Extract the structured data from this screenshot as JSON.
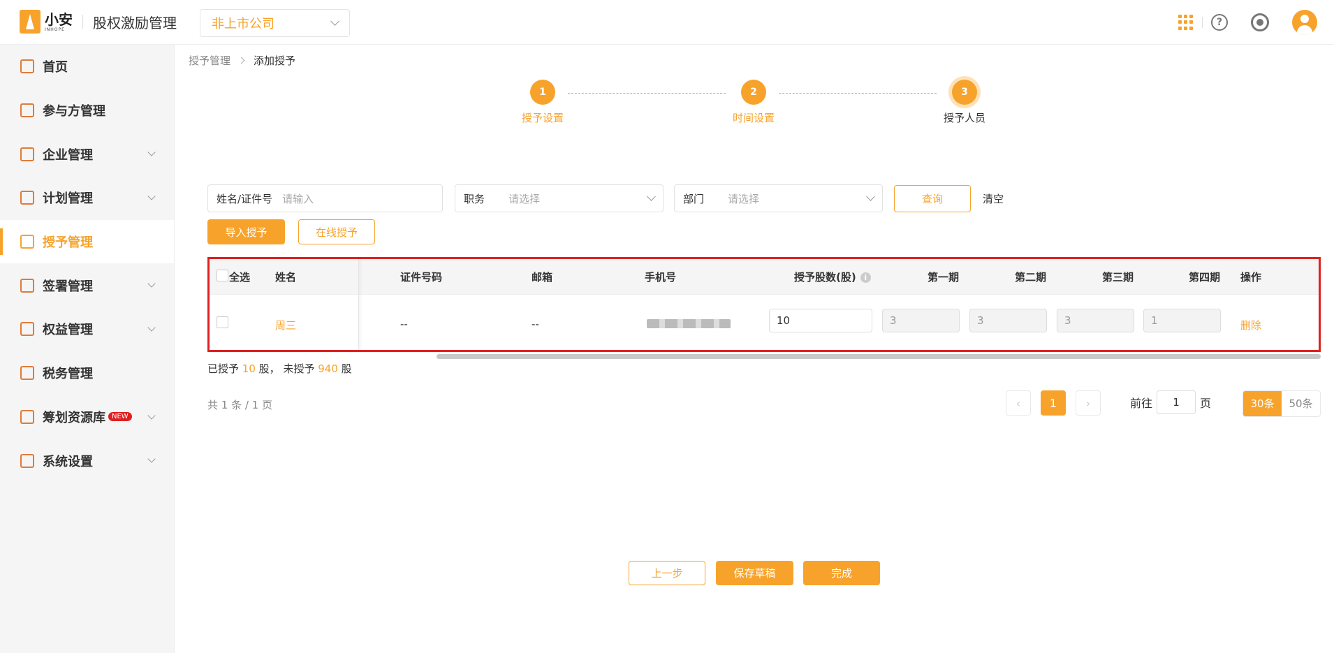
{
  "header": {
    "logo_cn": "小安",
    "logo_en": "INHOPE",
    "app_title": "股权激励管理",
    "company_select": "非上市公司",
    "help_symbol": "?"
  },
  "sidebar": {
    "items": [
      {
        "label": "首页",
        "icon": "home-icon"
      },
      {
        "label": "参与方管理",
        "icon": "users-icon"
      },
      {
        "label": "企业管理",
        "icon": "enterprise-icon"
      },
      {
        "label": "计划管理",
        "icon": "plan-icon"
      },
      {
        "label": "授予管理",
        "icon": "grant-icon"
      },
      {
        "label": "签署管理",
        "icon": "sign-icon"
      },
      {
        "label": "权益管理",
        "icon": "equity-icon"
      },
      {
        "label": "税务管理",
        "icon": "tax-icon"
      },
      {
        "label": "筹划资源库",
        "icon": "layers-icon",
        "badge": "NEW"
      },
      {
        "label": "系统设置",
        "icon": "settings-icon"
      }
    ]
  },
  "breadcrumb": {
    "parent": "授予管理",
    "current": "添加授予"
  },
  "steps": [
    {
      "num": "1",
      "label": "授予设置"
    },
    {
      "num": "2",
      "label": "时间设置"
    },
    {
      "num": "3",
      "label": "授予人员"
    }
  ],
  "filters": {
    "name_label": "姓名/证件号",
    "name_placeholder": "请输入",
    "position_label": "职务",
    "position_placeholder": "请选择",
    "dept_label": "部门",
    "dept_placeholder": "请选择",
    "query": "查询",
    "clear": "清空"
  },
  "actions": {
    "import": "导入授予",
    "online": "在线授予"
  },
  "table": {
    "headers": {
      "select_all": "全选",
      "name": "姓名",
      "id_no": "证件号码",
      "email": "邮箱",
      "phone": "手机号",
      "shares": "授予股数(股)",
      "p1": "第一期",
      "p2": "第二期",
      "p3": "第三期",
      "p4": "第四期",
      "op": "操作"
    },
    "rows": [
      {
        "name": "周三",
        "id_no": "--",
        "email": "--",
        "shares": "10",
        "p1": "3",
        "p2": "3",
        "p3": "3",
        "p4": "1",
        "op": "删除"
      }
    ],
    "info_symbol": "i"
  },
  "summary": {
    "granted_pre": "已授予",
    "granted": "10",
    "granted_unit": "股，",
    "ungranted_pre": "未授予",
    "ungranted": "940",
    "ungranted_unit": "股"
  },
  "pagination": {
    "total_text": "共 1 条 / 1 页",
    "current": "1",
    "goto_pre": "前往",
    "goto_value": "1",
    "goto_post": "页",
    "size_30": "30条",
    "size_50": "50条",
    "prev": "‹",
    "next": "›"
  },
  "footer": {
    "prev": "上一步",
    "save": "保存草稿",
    "done": "完成"
  },
  "colors": {
    "accent": "#f7a32b",
    "highlight_border": "#e02020",
    "new_badge": "#e02020"
  }
}
